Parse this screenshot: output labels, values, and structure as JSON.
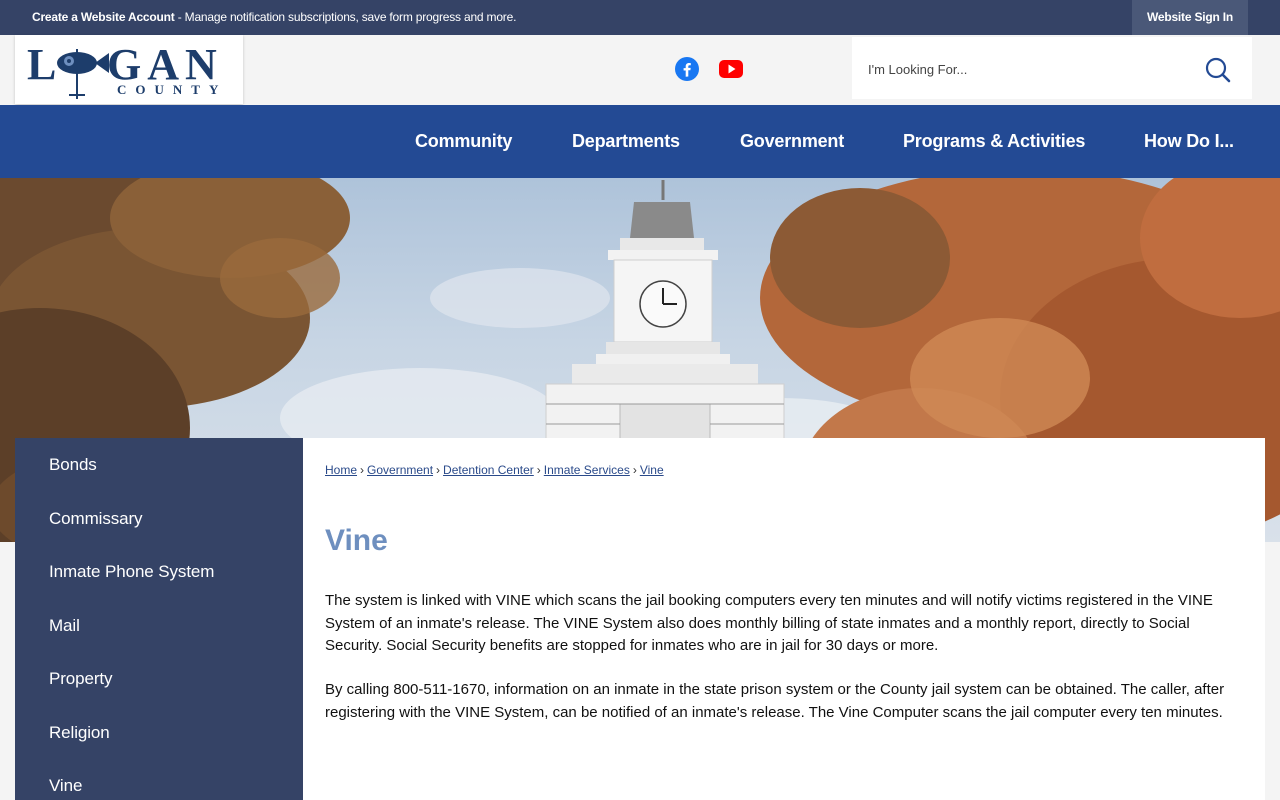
{
  "topbar": {
    "account_link": "Create a Website Account",
    "message": " - Manage notification subscriptions, save form progress and more.",
    "sign_in": "Website Sign In"
  },
  "header": {
    "logo_main": "LOGAN",
    "logo_sub": "COUNTY",
    "social": [
      "facebook-icon",
      "youtube-icon"
    ],
    "search": {
      "placeholder": "I'm Looking For..."
    }
  },
  "nav": {
    "items": [
      "Community",
      "Departments",
      "Government",
      "Programs & Activities",
      "How Do I..."
    ]
  },
  "sidebar": {
    "items": [
      "Bonds",
      "Commissary",
      "Inmate Phone System",
      "Mail",
      "Property",
      "Religion",
      "Vine"
    ]
  },
  "breadcrumb": [
    "Home",
    "Government",
    "Detention Center",
    "Inmate Services",
    "Vine"
  ],
  "page": {
    "title": "Vine",
    "paragraphs": [
      "The system is linked with VINE which scans the jail booking computers every ten minutes and will notify victims registered in the VINE System of an inmate's release. The VINE System also does monthly billing of state inmates and a monthly report, directly to Social Security. Social Security benefits are stopped for inmates who are in jail for 30 days or more.",
      "By calling 800-511-1670, information on an inmate in the state prison system or the County jail system can be obtained. The caller, after registering with the VINE System, can be notified of an inmate's release. The Vine Computer scans the jail computer every ten minutes."
    ]
  },
  "colors": {
    "topbar": "#354366",
    "nav": "#234a94",
    "sidebar": "#354366",
    "title": "#6e8fbf",
    "link": "#2a4a8a"
  }
}
